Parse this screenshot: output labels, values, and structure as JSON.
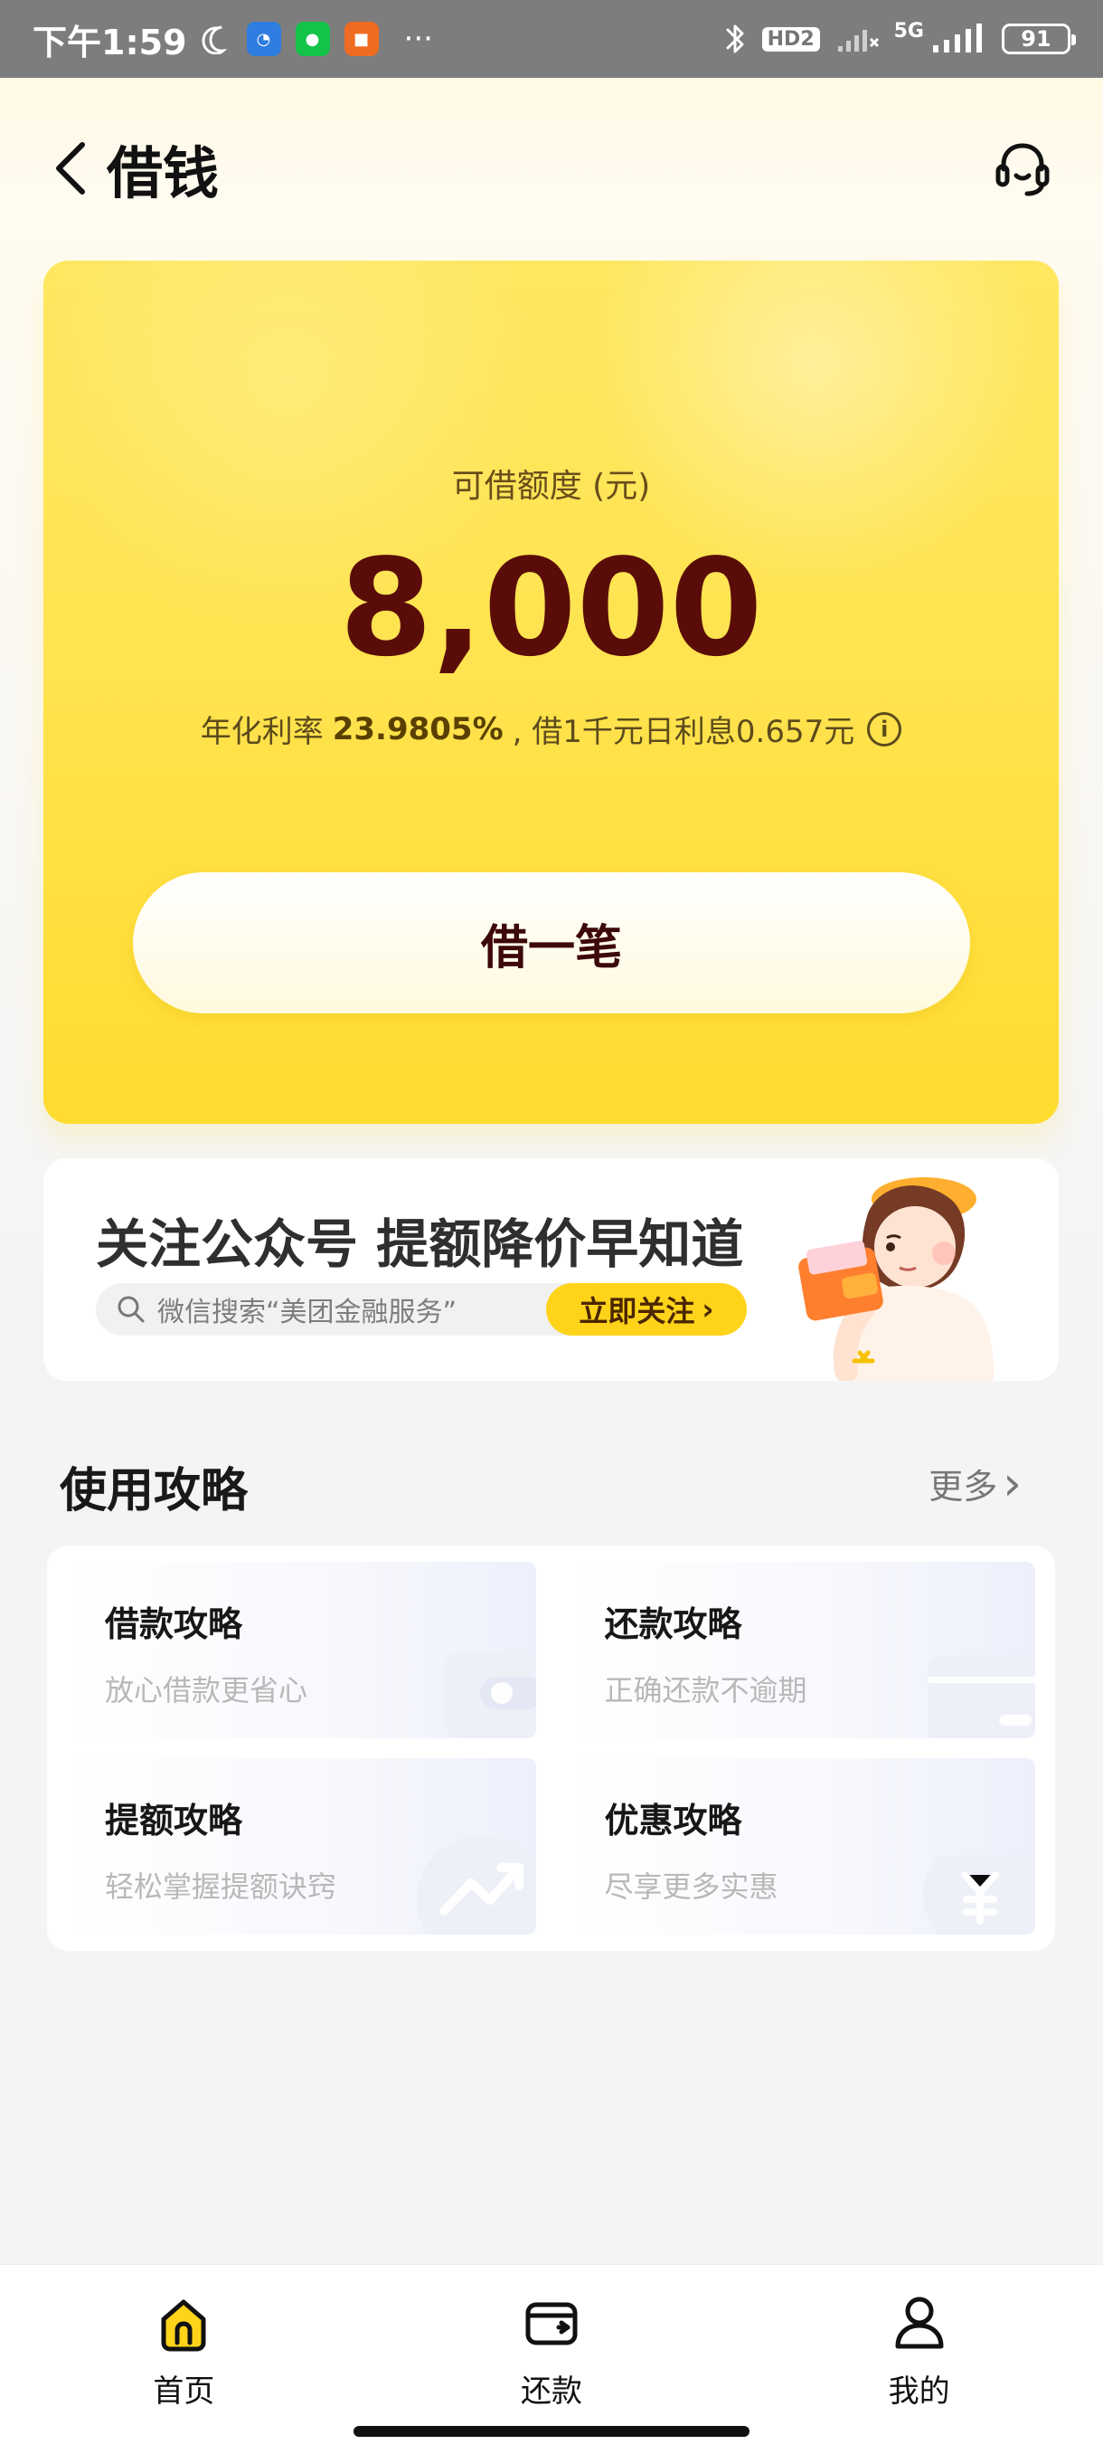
{
  "status_bar": {
    "time": "下午1:59",
    "app_icons": [
      "moon-icon",
      "browser-icon",
      "wechat-icon",
      "app-icon"
    ],
    "more": "···",
    "network_label": "HD2",
    "signal_label": "5G",
    "battery": "91"
  },
  "header": {
    "title": "借钱"
  },
  "credit": {
    "label": "可借额度 (元)",
    "amount": "8,000",
    "rate_prefix": "年化利率",
    "rate_value": "23.9805%",
    "rate_suffix": ", 借1千元日利息0.657元",
    "button": "借一笔"
  },
  "promo": {
    "title": "关注公众号 提额降价早知道",
    "search_text": "微信搜索“美团金融服务”",
    "button": "立即关注",
    "button_arrow": "›"
  },
  "guides": {
    "title": "使用攻略",
    "more": "更多",
    "more_arrow": "›",
    "items": [
      {
        "title": "借款攻略",
        "desc": "放心借款更省心",
        "icon": "wallet-icon"
      },
      {
        "title": "还款攻略",
        "desc": "正确还款不逾期",
        "icon": "card-icon"
      },
      {
        "title": "提额攻略",
        "desc": "轻松掌握提额诀窍",
        "icon": "trend-icon"
      },
      {
        "title": "优惠攻略",
        "desc": "尽享更多实惠",
        "icon": "coupon-icon"
      }
    ]
  },
  "bottom_nav": [
    {
      "label": "首页",
      "icon": "home-icon"
    },
    {
      "label": "还款",
      "icon": "repay-icon"
    },
    {
      "label": "我的",
      "icon": "profile-icon"
    }
  ],
  "colors": {
    "accent": "#ffd31a",
    "amount": "#5a0d08"
  }
}
